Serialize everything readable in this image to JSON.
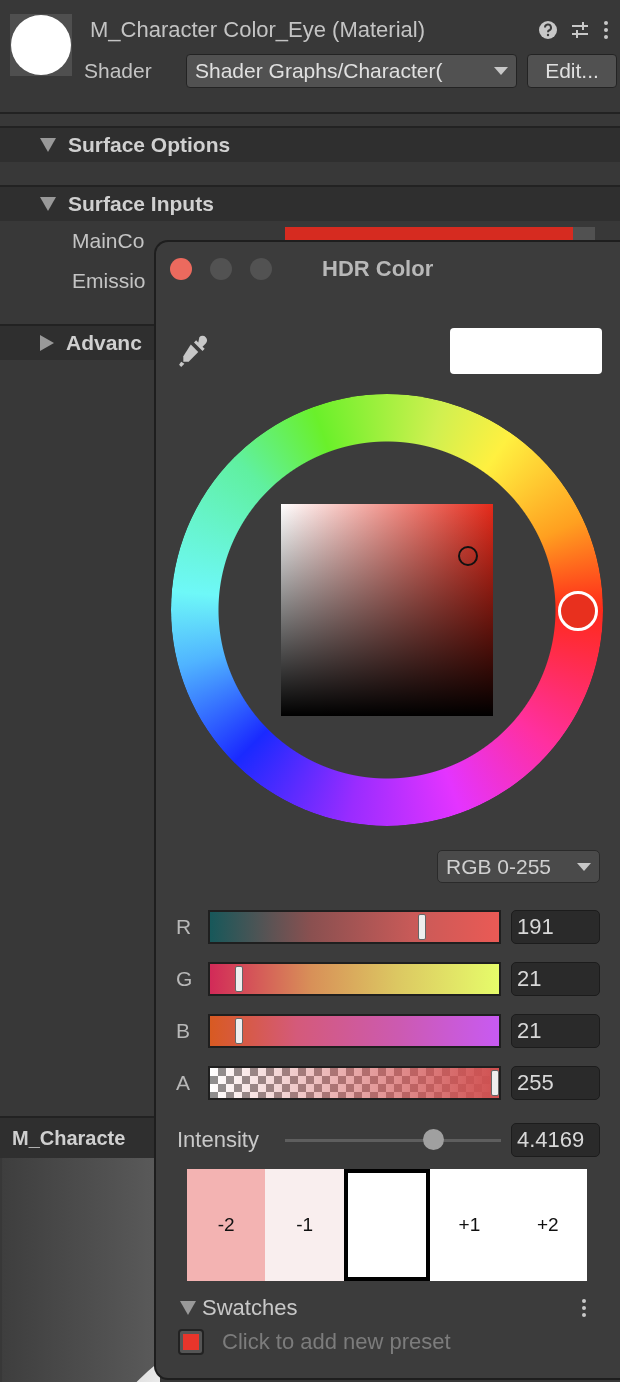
{
  "inspector": {
    "title": "M_Character Color_Eye (Material)",
    "shader_label": "Shader",
    "shader_value": "Shader Graphs/Character(",
    "edit_button": "Edit...",
    "sections": [
      {
        "title": "Surface Options",
        "expanded": true
      },
      {
        "title": "Surface Inputs",
        "expanded": true,
        "properties": [
          {
            "label": "MainCo",
            "kind": "color"
          },
          {
            "label": "Emissio",
            "kind": "text"
          }
        ]
      },
      {
        "title": "Advanc",
        "expanded": false
      }
    ]
  },
  "preview": {
    "title": "M_Characte"
  },
  "color_picker": {
    "title": "HDR Color",
    "mode": "RGB 0-255",
    "channels": [
      {
        "label": "R",
        "level": 0.74,
        "value": "191"
      },
      {
        "label": "G",
        "level": 0.09,
        "value": "21"
      },
      {
        "label": "B",
        "level": 0.09,
        "value": "21"
      },
      {
        "label": "A",
        "level": 1,
        "value": "255"
      }
    ],
    "intensity": {
      "label": "Intensity",
      "level": 0.69,
      "value": "4.4169"
    },
    "exposure_swatches": [
      {
        "label": "-2",
        "color": "#f3b3b2",
        "selected": false
      },
      {
        "label": "-1",
        "color": "#f9eeee",
        "selected": false
      },
      {
        "color": "#ffffff",
        "selected": true
      },
      {
        "label": "+1",
        "color": "#ffffff",
        "selected": false
      },
      {
        "label": "+2",
        "color": "#ffffff",
        "selected": false
      }
    ],
    "swatches": {
      "title": "Swatches",
      "expanded": true,
      "presets": [
        {
          "color": "#e8352b"
        }
      ],
      "placeholder": "Click to add new preset"
    }
  }
}
